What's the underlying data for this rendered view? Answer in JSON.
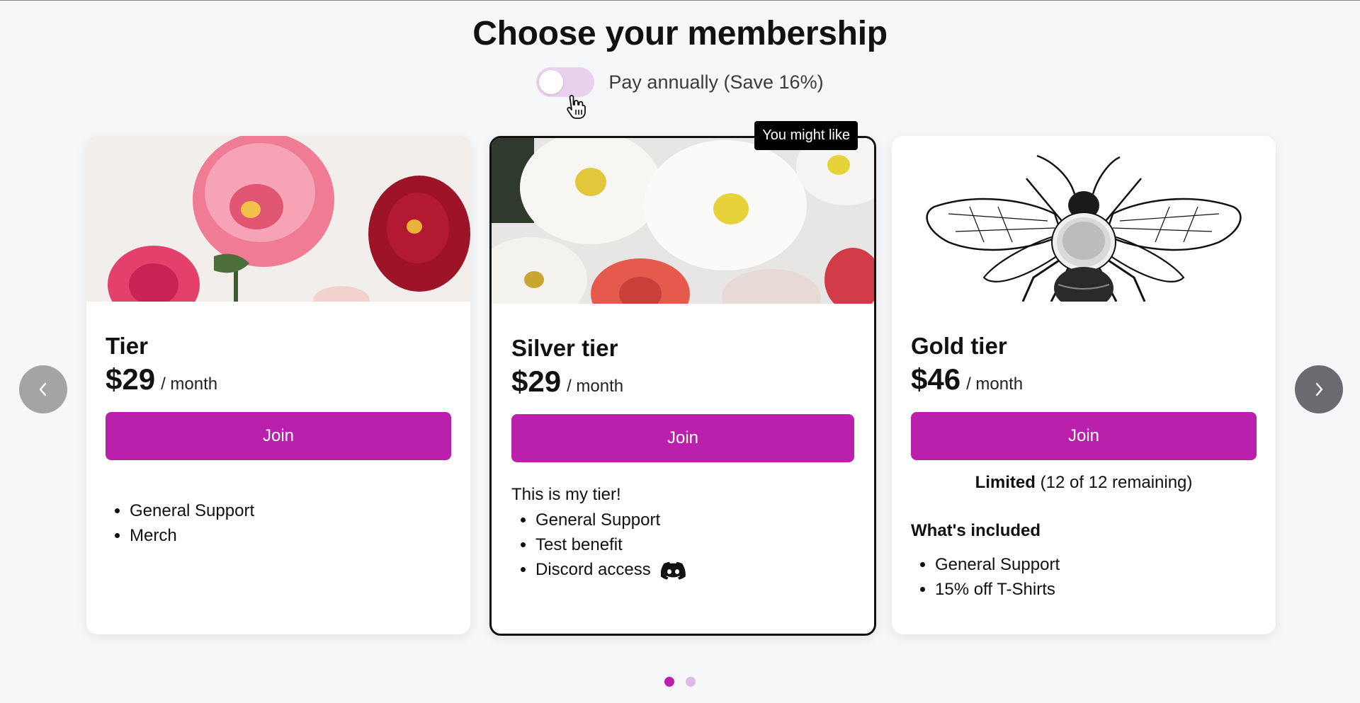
{
  "page": {
    "title": "Choose your membership"
  },
  "billing": {
    "toggle_label": "Pay annually (Save 16%)",
    "annual_enabled": false
  },
  "tiers": [
    {
      "name": "Tier",
      "price": "$29",
      "period": "/ month",
      "join_label": "Join",
      "image_icon": "flowers-image",
      "benefits": [
        "General Support",
        "Merch"
      ]
    },
    {
      "name": "Silver tier",
      "price": "$29",
      "period": "/ month",
      "join_label": "Join",
      "badge": "You might like",
      "description": "This is my tier!",
      "image_icon": "white-peonies-image",
      "benefits": [
        "General Support",
        "Test benefit",
        "Discord access"
      ],
      "benefit_icon": "discord-icon"
    },
    {
      "name": "Gold tier",
      "price": "$46",
      "period": "/ month",
      "join_label": "Join",
      "limited_label": "Limited",
      "limited_count": "(12 of 12 remaining)",
      "included_title": "What's included",
      "image_icon": "bee-illustration",
      "benefits": [
        "General Support",
        "15% off T-Shirts"
      ]
    }
  ],
  "carousel": {
    "prev_icon": "chevron-left-icon",
    "next_icon": "chevron-right-icon",
    "pages": 2,
    "active_page": 1
  },
  "colors": {
    "accent": "#bb20ac",
    "toggle_bg": "#ead2ee",
    "inactive_dot": "#e1b7e3"
  }
}
